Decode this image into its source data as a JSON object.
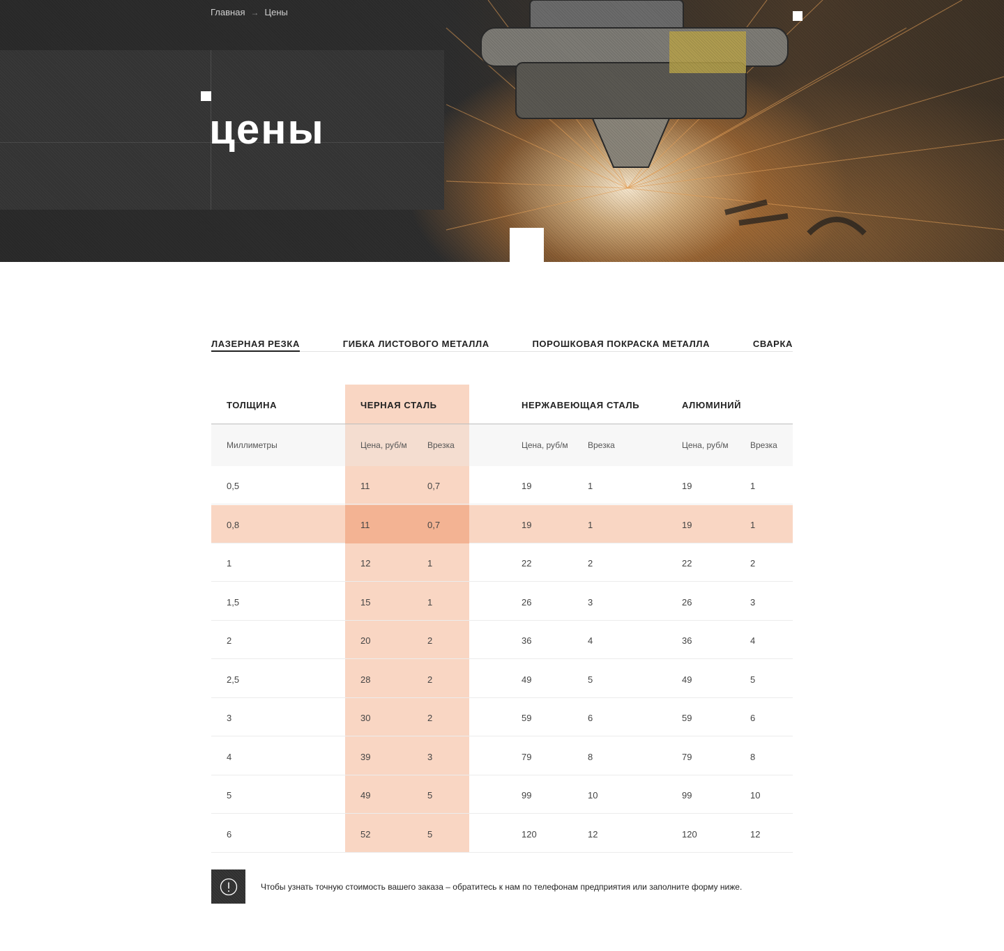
{
  "breadcrumb": {
    "home": "Главная",
    "separator": "→",
    "current": "Цены"
  },
  "page": {
    "title": "цены"
  },
  "tabs": [
    {
      "label": "Лазерная резка",
      "active": true
    },
    {
      "label": "Гибка листового металла",
      "active": false
    },
    {
      "label": "Порошковая покраска металла",
      "active": false
    },
    {
      "label": "Сварка",
      "active": false
    }
  ],
  "table": {
    "headers": [
      "Толщина",
      "Черная сталь",
      "Нержавеющая сталь",
      "Алюминий"
    ],
    "subheaders": {
      "thickness": "Миллиметры",
      "price": "Цена, руб/м",
      "pierce": "Врезка"
    },
    "rows": [
      [
        "0,5",
        "11",
        "0,7",
        "19",
        "1",
        "19",
        "1"
      ],
      [
        "0,8",
        "11",
        "0,7",
        "19",
        "1",
        "19",
        "1"
      ],
      [
        "1",
        "12",
        "1",
        "22",
        "2",
        "22",
        "2"
      ],
      [
        "1,5",
        "15",
        "1",
        "26",
        "3",
        "26",
        "3"
      ],
      [
        "2",
        "20",
        "2",
        "36",
        "4",
        "36",
        "4"
      ],
      [
        "2,5",
        "28",
        "2",
        "49",
        "5",
        "49",
        "5"
      ],
      [
        "3",
        "30",
        "2",
        "59",
        "6",
        "59",
        "6"
      ],
      [
        "4",
        "39",
        "3",
        "79",
        "8",
        "79",
        "8"
      ],
      [
        "5",
        "49",
        "5",
        "99",
        "10",
        "99",
        "10"
      ],
      [
        "6",
        "52",
        "5",
        "120",
        "12",
        "120",
        "12"
      ]
    ],
    "highlight_row_index": 1,
    "highlight_column": "Черная сталь"
  },
  "note": {
    "icon": "exclamation-circle-icon",
    "text": "Чтобы узнать точную стоимость вашего заказа – обратитесь к нам по телефонам предприятия или заполните форму ниже."
  },
  "colors": {
    "accent_light": "#f9d6c3",
    "accent_dark": "#f3b393",
    "hero_dark": "#2e2e2e"
  }
}
